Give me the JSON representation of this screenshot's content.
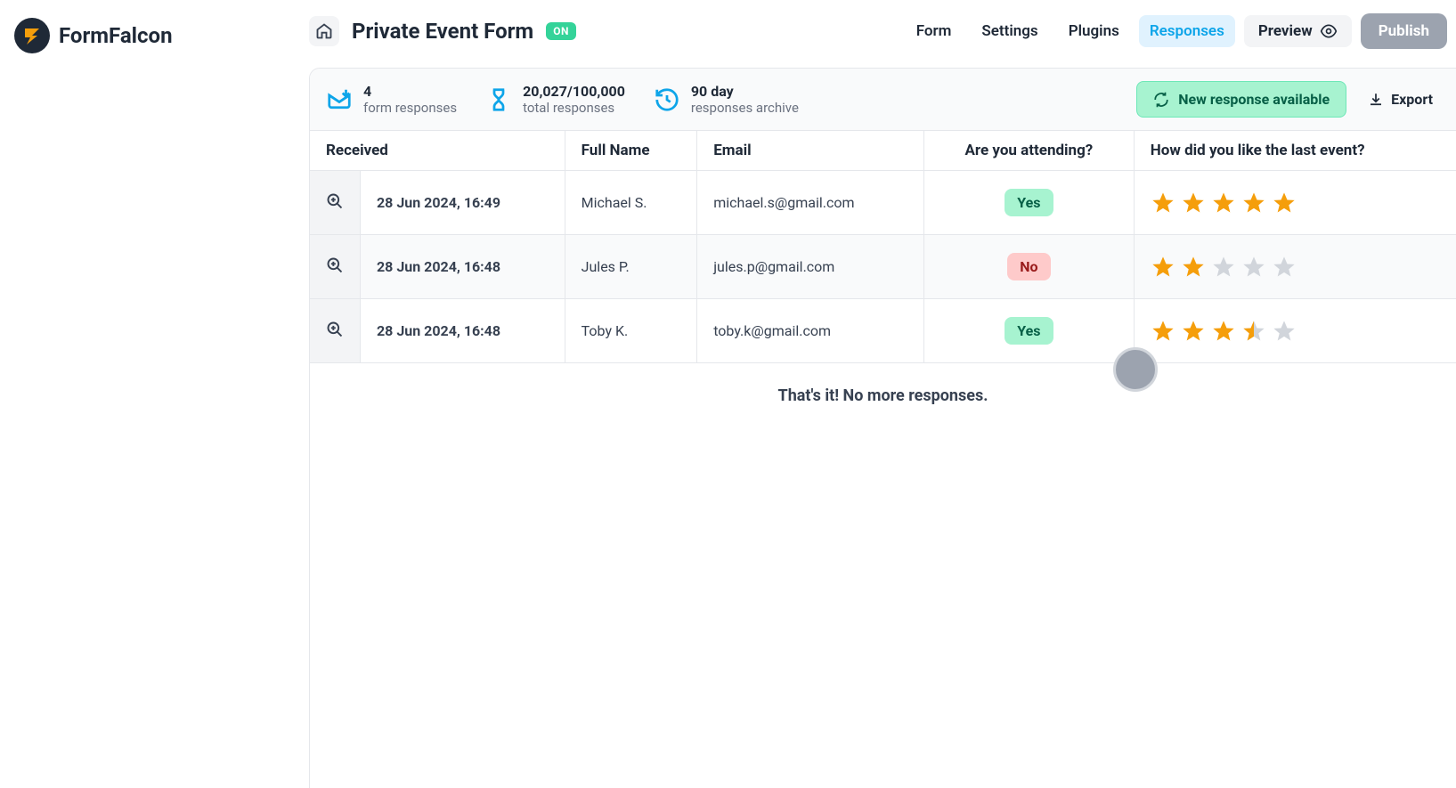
{
  "brand": {
    "name": "FormFalcon"
  },
  "header": {
    "form_title": "Private Event Form",
    "status_badge": "ON",
    "nav": {
      "form": "Form",
      "settings": "Settings",
      "plugins": "Plugins",
      "responses": "Responses"
    },
    "preview_label": "Preview",
    "publish_label": "Publish"
  },
  "stats": {
    "responses": {
      "value": "4",
      "label": "form responses"
    },
    "total": {
      "value": "20,027/100,000",
      "label": "total responses"
    },
    "archive": {
      "value": "90 day",
      "label": "responses archive"
    },
    "new_response_label": "New response available",
    "export_label": "Export"
  },
  "table": {
    "headers": {
      "received": "Received",
      "full_name": "Full Name",
      "email": "Email",
      "attending": "Are you attending?",
      "rating": "How did you like the last event?"
    },
    "rows": [
      {
        "received": "28 Jun 2024, 16:49",
        "name": "Michael S.",
        "email": "michael.s@gmail.com",
        "attending": "Yes",
        "rating": 5
      },
      {
        "received": "28 Jun 2024, 16:48",
        "name": "Jules P.",
        "email": "jules.p@gmail.com",
        "attending": "No",
        "rating": 2
      },
      {
        "received": "28 Jun 2024, 16:48",
        "name": "Toby K.",
        "email": "toby.k@gmail.com",
        "attending": "Yes",
        "rating": 3.5
      }
    ],
    "end_message": "That's it! No more responses."
  }
}
